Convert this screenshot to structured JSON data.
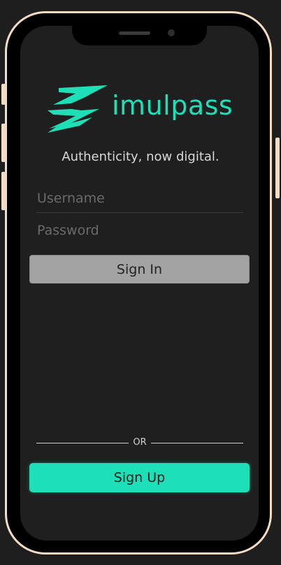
{
  "app": {
    "logo_text": "imulpass",
    "tagline": "Authenticity, now digital."
  },
  "login": {
    "username_placeholder": "Username",
    "password_placeholder": "Password",
    "sign_in_label": "Sign In"
  },
  "divider": {
    "or_label": "OR"
  },
  "signup": {
    "sign_up_label": "Sign Up"
  },
  "colors": {
    "accent": "#1ee0b8",
    "frame": "#f3dcc4",
    "background": "#1f1f1f",
    "sign_in_button": "#a3a3a3"
  },
  "icons": {
    "logo_mark": "stylized-s-icon"
  }
}
